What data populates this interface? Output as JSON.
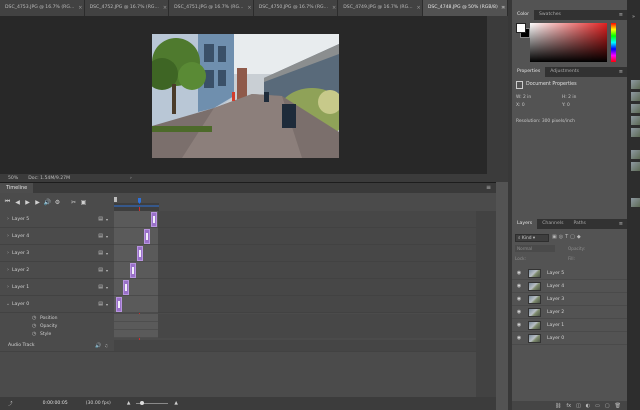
{
  "tabs": [
    {
      "label": "DSC_4753.JPG @ 16.7% (RG...",
      "active": false
    },
    {
      "label": "DSC_4752.JPG @ 16.7% (RG...",
      "active": false
    },
    {
      "label": "DSC_4751.JPG @ 16.7% (RG...",
      "active": false
    },
    {
      "label": "DSC_4750.JPG @ 16.7% (RG...",
      "active": false
    },
    {
      "label": "DSC_4749.JPG @ 16.7% (RG...",
      "active": false
    },
    {
      "label": "DSC_4748.JPG @ 50% (RGB/8)",
      "active": true
    }
  ],
  "tab_overflow": "»",
  "status": {
    "zoom": "50%",
    "doc": "Doc: 1.54M/9.27M",
    "arrow": "›"
  },
  "timeline": {
    "title": "Timeline",
    "layers": [
      {
        "name": "Layer 5"
      },
      {
        "name": "Layer 4"
      },
      {
        "name": "Layer 3"
      },
      {
        "name": "Layer 2"
      },
      {
        "name": "Layer 1"
      },
      {
        "name": "Layer 0",
        "expanded": true
      }
    ],
    "properties": [
      "Position",
      "Opacity",
      "Style"
    ],
    "audio_track": "Audio Track",
    "footer_time": "0:00:00:05",
    "footer_fps": "(30.00 fps)"
  },
  "color_panel": {
    "tabs": [
      "Color",
      "Swatches"
    ]
  },
  "props_panel": {
    "tabs": [
      "Properties",
      "Adjustments"
    ],
    "title": "Document Properties",
    "w_label": "W: 2 in",
    "h_label": "H: 2 in",
    "x_label": "X: 0",
    "y_label": "Y: 0",
    "resolution": "Resolution: 300 pixels/inch"
  },
  "layers_panel": {
    "tabs": [
      "Layers",
      "Channels",
      "Paths"
    ],
    "kind": "Kind",
    "blend": "Normal",
    "opacity_label": "Opacity:",
    "lock_label": "Lock:",
    "fill_label": "Fill:",
    "items": [
      "Layer 5",
      "Layer 4",
      "Layer 3",
      "Layer 2",
      "Layer 1",
      "Layer 0"
    ]
  },
  "icons": {
    "first_frame": "⏮",
    "prev_frame": "◀",
    "play": "▶",
    "next_frame": "▶",
    "audio": "🔊",
    "settings": "⚙",
    "split": "✂",
    "transition": "▣",
    "eye": "◉",
    "plus": "+",
    "chevron_right": "›",
    "chevron_down": "⌄",
    "film": "▤",
    "stopwatch": "◷",
    "note": "♫",
    "menu": "≡"
  },
  "colors": {
    "clip": "#9a71c9",
    "playhead": "#d02c2c",
    "accent": "#2f71d8"
  }
}
